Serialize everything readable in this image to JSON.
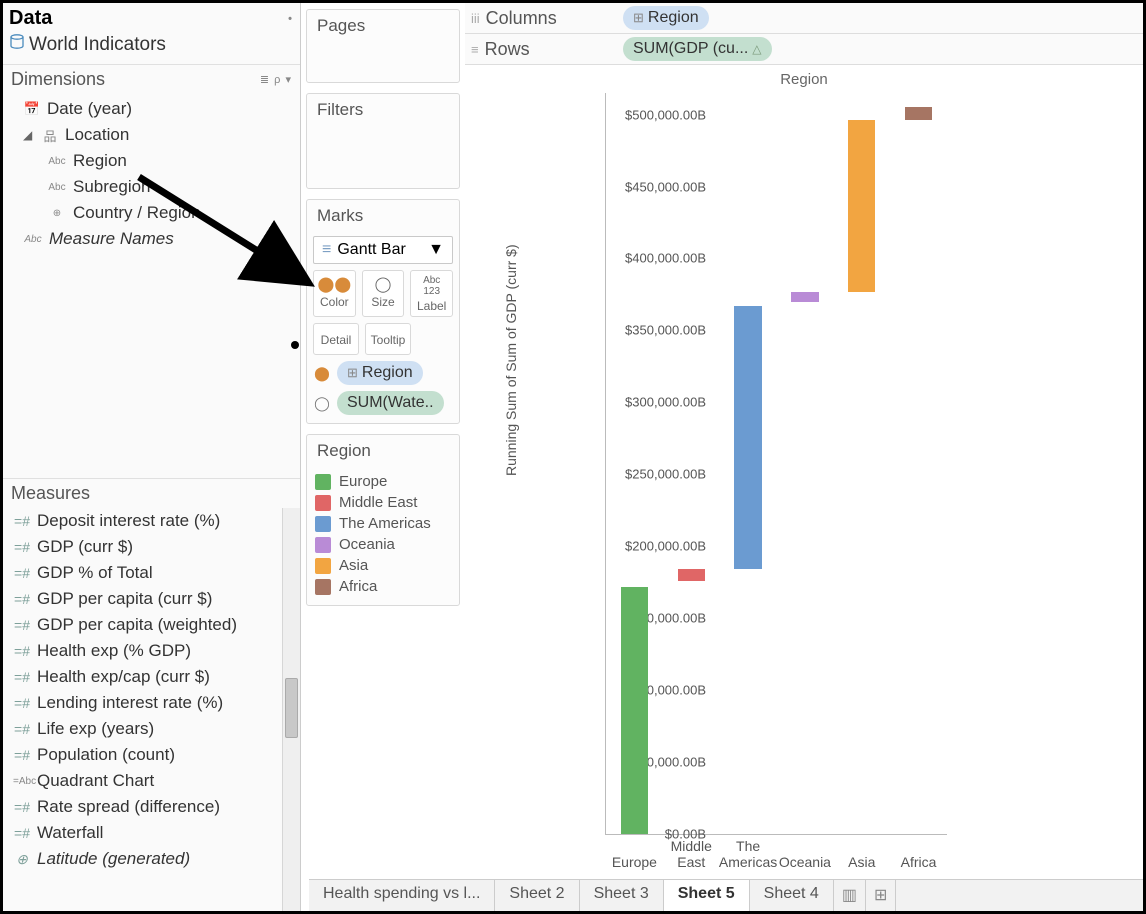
{
  "data_panel": {
    "title": "Data",
    "datasource": "World Indicators",
    "dimensions_label": "Dimensions",
    "dimensions_tools": "≣ ρ ▾",
    "dimensions": {
      "date": "Date (year)",
      "location": "Location",
      "region": "Region",
      "subregion": "Subregion",
      "country": "Country / Region",
      "measure_names": "Measure Names"
    },
    "measures_label": "Measures",
    "measures": [
      "Deposit interest rate (%)",
      "GDP (curr $)",
      "GDP % of Total",
      "GDP per capita (curr $)",
      "GDP per capita (weighted)",
      "Health exp (% GDP)",
      "Health exp/cap (curr $)",
      "Lending interest rate (%)",
      "Life exp (years)",
      "Population (count)",
      "Quadrant Chart",
      "Rate spread (difference)",
      "Waterfall",
      "Latitude (generated)"
    ]
  },
  "shelves": {
    "pages": "Pages",
    "filters": "Filters",
    "marks": "Marks",
    "marktype": "Gantt Bar",
    "color": "Color",
    "size": "Size",
    "label": "Label",
    "detail": "Detail",
    "tooltip": "Tooltip",
    "pill_region": "Region",
    "pill_size": "SUM(Wate..",
    "legend_title": "Region"
  },
  "top": {
    "columns": "Columns",
    "rows": "Rows",
    "col_pill": "Region",
    "row_pill": "SUM(GDP (cu..."
  },
  "chart_data": {
    "type": "bar",
    "title": "Region",
    "ylabel": "Running Sum of Sum of GDP (curr $)",
    "ylim": [
      0,
      500000
    ],
    "yticks": [
      "$0.00B",
      "$50,000.00B",
      "$100,000.00B",
      "$150,000.00B",
      "$200,000.00B",
      "$250,000.00B",
      "$300,000.00B",
      "$350,000.00B",
      "$400,000.00B",
      "$450,000.00B",
      "$500,000.00B"
    ],
    "ytick_values": [
      0,
      50000,
      100000,
      150000,
      200000,
      250000,
      300000,
      350000,
      400000,
      450000,
      500000
    ],
    "categories": [
      "Europe",
      "Middle East",
      "The Americas",
      "Oceania",
      "Asia",
      "Africa"
    ],
    "series": [
      {
        "name": "Europe",
        "start": 0,
        "end": 172000,
        "color": "#61b361"
      },
      {
        "name": "Middle East",
        "start": 176000,
        "end": 184000,
        "color": "#e06666"
      },
      {
        "name": "The Americas",
        "start": 184000,
        "end": 367000,
        "color": "#6b9bd1"
      },
      {
        "name": "Oceania",
        "start": 370000,
        "end": 377000,
        "color": "#b98bd6"
      },
      {
        "name": "Asia",
        "start": 377000,
        "end": 496000,
        "color": "#f2a541"
      },
      {
        "name": "Africa",
        "start": 496000,
        "end": 505000,
        "color": "#a67563"
      }
    ],
    "legend": [
      {
        "name": "Europe",
        "color": "#61b361"
      },
      {
        "name": "Middle East",
        "color": "#e06666"
      },
      {
        "name": "The Americas",
        "color": "#6b9bd1"
      },
      {
        "name": "Oceania",
        "color": "#b98bd6"
      },
      {
        "name": "Asia",
        "color": "#f2a541"
      },
      {
        "name": "Africa",
        "color": "#a67563"
      }
    ]
  },
  "tabs": {
    "items": [
      "Health spending vs l...",
      "Sheet 2",
      "Sheet 3",
      "Sheet 5",
      "Sheet 4"
    ],
    "active": "Sheet 5"
  }
}
